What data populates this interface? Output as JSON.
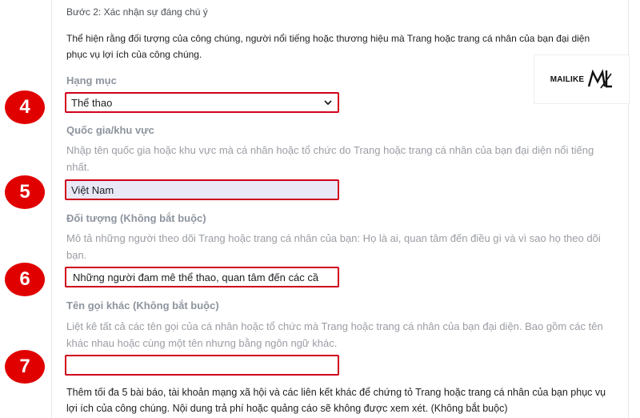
{
  "step": {
    "title": "Bước 2: Xác nhận sự đáng chú ý",
    "description": "Thể hiện rằng đối tượng của công chúng, người nổi tiếng hoặc thương hiệu mà Trang hoặc trang cá nhân của bạn đại diện phục vụ lợi ích của công chúng."
  },
  "watermark": {
    "text": "MAILIKE",
    "mark": "ML"
  },
  "fields": {
    "category": {
      "badge": "4",
      "label": "Hạng mục",
      "value": "Thể thao",
      "icon": "chevron-down-icon"
    },
    "country": {
      "badge": "5",
      "label": "Quốc gia/khu vực",
      "hint": "Nhập tên quốc gia hoặc khu vực mà cá nhân hoặc tổ chức do Trang hoặc trang cá nhân của bạn đại diện nổi tiếng nhất.",
      "value": "Việt Nam"
    },
    "audience": {
      "badge": "6",
      "label": "Đối tượng (Không bắt buộc)",
      "hint": "Mô tả những người theo dõi Trang hoặc trang cá nhân của bạn: Họ là ai, quan tâm đến điều gì và vì sao họ theo dõi bạn.",
      "value": "Những người đam mê thể thao, quan tâm đến các cầ"
    },
    "alias": {
      "badge": "7",
      "label": "Tên gọi khác (Không bắt buộc)",
      "hint": "Liệt kê tất cả các tên gọi của cá nhân hoặc tổ chức mà Trang hoặc trang cá nhân của bạn đại diện. Bao gồm các tên khác nhau hoặc cùng một tên nhưng bằng ngôn ngữ khác.",
      "value": ""
    }
  },
  "footer": {
    "text": "Thêm tối đa 5 bài báo, tài khoản mạng xã hội và các liên kết khác để chứng tỏ Trang hoặc trang cá nhân của bạn phục vụ lợi ích của công chúng. Nội dung trả phí hoặc quảng cáo sẽ không được xem xét. (Không bắt buộc)"
  },
  "colors": {
    "badge": "#e00000",
    "field_border": "#d0021b",
    "filled_field": "#e8e8f7"
  }
}
